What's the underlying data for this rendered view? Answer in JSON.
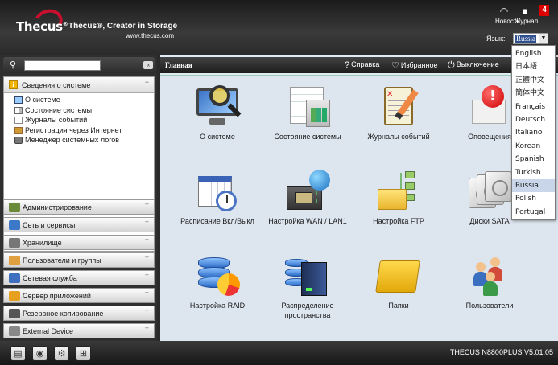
{
  "brand": {
    "logo": "Thecus",
    "tagline": "Thecus®, Creator in Storage",
    "site": "www.thecus.com"
  },
  "header": {
    "news_label": "Новости",
    "journal_label": "Журнал",
    "journal_badge": "4",
    "language_label": "Язык:",
    "language_value": "Russia",
    "language_options": [
      "English",
      "日本語",
      "正體中文",
      "簡体中文",
      "Français",
      "Deutsch",
      "Italiano",
      "Korean",
      "Spanish",
      "Turkish",
      "Russia",
      "Polish",
      "Portugal"
    ]
  },
  "sidebar": {
    "search_placeholder": "",
    "collapse_glyph": "«",
    "sysinfo": {
      "title": "Сведения о системе",
      "toggle": "−",
      "items": [
        "О системе",
        "Состояние системы",
        "Журналы событий",
        "Регистрация через Интернет",
        "Менеджер системных логов"
      ]
    },
    "sections": [
      {
        "label": "Администрирование",
        "color": "#6a8a3a"
      },
      {
        "label": "Сеть и сервисы",
        "color": "#3c78c8"
      },
      {
        "label": "Хранилище",
        "color": "#777777"
      },
      {
        "label": "Пользователи и группы",
        "color": "#e0a040"
      },
      {
        "label": "Сетевая служба",
        "color": "#3f6fbf"
      },
      {
        "label": "Сервер приложений",
        "color": "#e6a020"
      },
      {
        "label": "Резервное копирование",
        "color": "#555555"
      },
      {
        "label": "External Device",
        "color": "#888888"
      }
    ],
    "plus_glyph": "+"
  },
  "main": {
    "title": "Главная",
    "help": "Справка",
    "favorites": "Избранное",
    "shutdown": "Выключение",
    "tiles": [
      {
        "label": "О системе"
      },
      {
        "label": "Состояние системы"
      },
      {
        "label": "Журналы событий"
      },
      {
        "label": "Оповещения"
      },
      {
        "label": "Расписание Вкл/Выкл"
      },
      {
        "label": "Настройка WAN / LAN1"
      },
      {
        "label": "Настройка FTP"
      },
      {
        "label": "Диски SATA"
      },
      {
        "label": "Настройка RAID"
      },
      {
        "label": "Распределение пространства"
      },
      {
        "label": "Папки"
      },
      {
        "label": "Пользователи"
      }
    ]
  },
  "footer": {
    "version": "THECUS N8800PLUS V5.01.05"
  },
  "colors": {
    "accent": "#c8102e",
    "header_bg": "#2b2b2b",
    "main_bg": "#dde5ef",
    "badge": "#dd0000"
  },
  "icons": {
    "news": "rss-icon",
    "journal": "speech-bubble-icon",
    "help": "question-circle-icon",
    "favorites": "heart-icon",
    "shutdown": "power-icon"
  }
}
